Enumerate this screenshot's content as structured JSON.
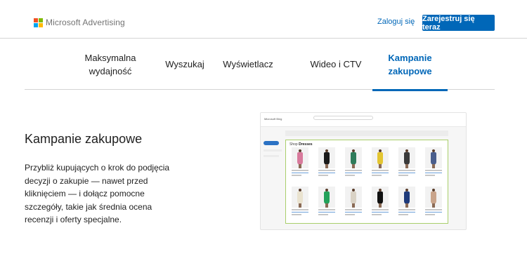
{
  "header": {
    "logo_text": "Microsoft Advertising",
    "logo_colors": [
      "#f25022",
      "#7fba00",
      "#00a4ef",
      "#ffb900"
    ],
    "login_label": "Zaloguj się",
    "register_label": "Zarejestruj się teraz"
  },
  "tabs": [
    {
      "label": "Maksymalna wydajność",
      "active": false
    },
    {
      "label": "Wyszukaj",
      "active": false
    },
    {
      "label": "Wyświetlacz",
      "active": false
    },
    {
      "label": "Wideo i CTV",
      "active": false
    },
    {
      "label": "Kampanie zakupowe",
      "active": true
    }
  ],
  "main": {
    "heading": "Kampanie zakupowe",
    "description": "Przybliż kupujących o krok do podjęcia decyzji o zakupie — nawet przed kliknięciem — i dołącz pomocne szczegóły, takie jak średnia ocena recenzji i oferty specjalne."
  },
  "preview": {
    "bing_label": "Microsoft Bing",
    "panel_title_prefix": "Shop",
    "panel_title": "Dresses"
  },
  "colors": {
    "accent": "#0067b8",
    "panel_border": "#a9cf6b"
  }
}
